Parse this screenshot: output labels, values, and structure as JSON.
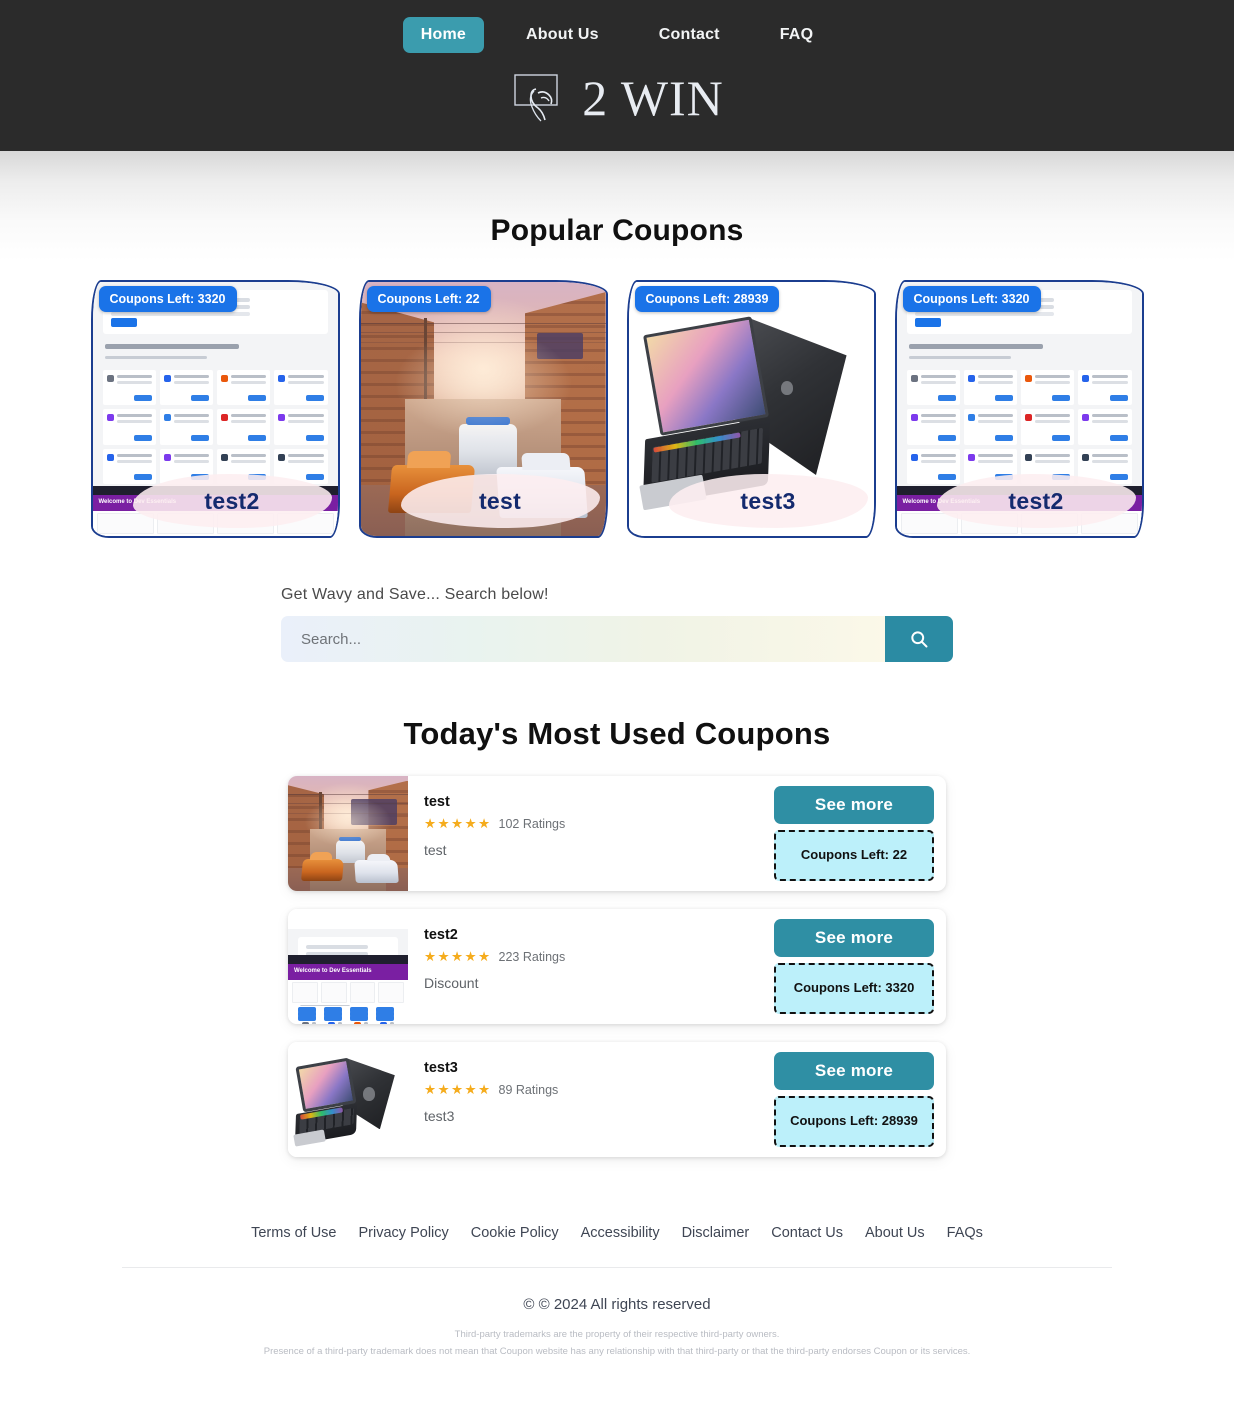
{
  "header": {
    "nav": [
      {
        "label": "Home",
        "active": true
      },
      {
        "label": "About Us",
        "active": false
      },
      {
        "label": "Contact",
        "active": false
      },
      {
        "label": "FAQ",
        "active": false
      }
    ],
    "logo_icon": "cursor-click-icon",
    "brand": "2 WIN",
    "background_color": "#2b2b2b",
    "accent_color": "#3b9cae"
  },
  "popular": {
    "title": "Popular Coupons",
    "cards": [
      {
        "badge": "Coupons Left: 3320",
        "label": "test2",
        "art": "dashboard"
      },
      {
        "badge": "Coupons Left: 22",
        "label": "test",
        "art": "street"
      },
      {
        "badge": "Coupons Left: 28939",
        "label": "test3",
        "art": "laptop"
      },
      {
        "badge": "Coupons Left: 3320",
        "label": "test2",
        "art": "dashboard"
      }
    ],
    "badge_color": "#1a73e8",
    "frame_color": "#1b3d8f"
  },
  "search": {
    "label": "Get Wavy and Save... Search below!",
    "placeholder": "Search...",
    "value": "",
    "button_icon": "search-icon",
    "button_color": "#2b8ba3"
  },
  "today": {
    "title": "Today's Most Used Coupons",
    "see_more_label": "See more",
    "rows": [
      {
        "title": "test",
        "stars": "★★★★★",
        "ratings": "102 Ratings",
        "description": "test",
        "coupons_left": "Coupons Left: 22",
        "art": "street"
      },
      {
        "title": "test2",
        "stars": "★★★★★",
        "ratings": "223 Ratings",
        "description": "Discount",
        "coupons_left": "Coupons Left: 3320",
        "art": "dashboard"
      },
      {
        "title": "test3",
        "stars": "★★★★★",
        "ratings": "89 Ratings",
        "description": "test3",
        "coupons_left": "Coupons Left: 28939",
        "art": "laptop"
      }
    ],
    "star_color": "#f5ac1d",
    "badge_color": "#bcf0fa"
  },
  "footer": {
    "links": [
      "Terms of Use",
      "Privacy Policy",
      "Cookie Policy",
      "Accessibility",
      "Disclaimer",
      "Contact Us",
      "About Us",
      "FAQs"
    ],
    "copyright": "© © 2024 All rights reserved",
    "fineprint_1": "Third-party trademarks are the property of their respective third-party owners.",
    "fineprint_2": "Presence of a third-party trademark does not mean that Coupon website has any relationship with that third-party or that the third-party endorses Coupon or its services."
  }
}
